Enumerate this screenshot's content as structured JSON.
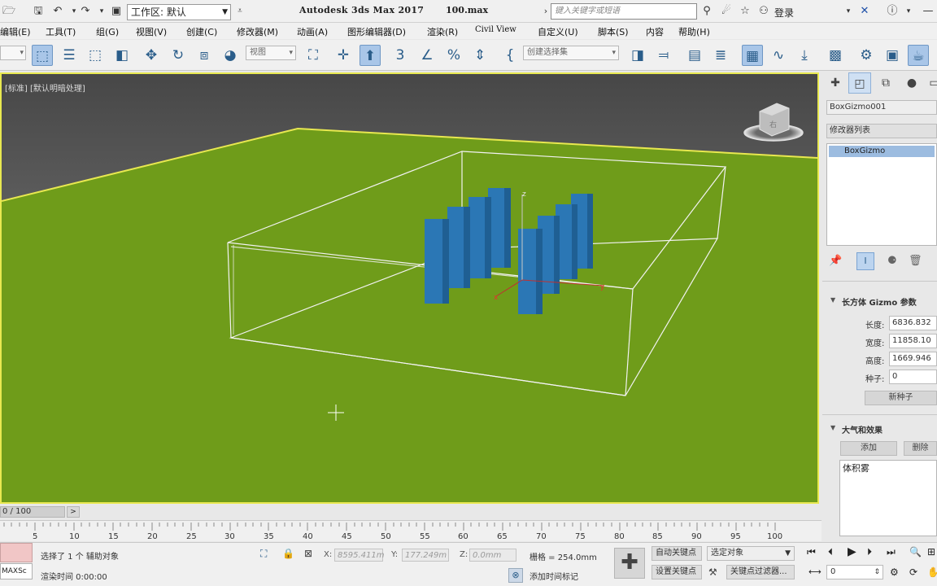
{
  "title_bar": {
    "workspace_label": "工作区: 默认",
    "app_title": "Autodesk 3ds Max 2017",
    "file_name": "100.max",
    "search_placeholder": "键入关键字或短语",
    "login": "登录"
  },
  "menu": [
    "编辑(E)",
    "工具(T)",
    "组(G)",
    "视图(V)",
    "创建(C)",
    "修改器(M)",
    "动画(A)",
    "图形编辑器(D)",
    "渲染(R)",
    "Civil View",
    "自定义(U)",
    "脚本(S)",
    "内容",
    "帮助(H)"
  ],
  "toolbar": {
    "view_dropdown": "视图",
    "selection_set_dropdown": "创建选择集"
  },
  "viewport": {
    "label": "[标准] [默认明暗处理]",
    "viewcube_label": "右",
    "axis_z": "z",
    "axis_y": "y",
    "axis_x": "x"
  },
  "panel": {
    "object_name": "BoxGizmo001",
    "modifier_list_label": "修改器列表",
    "modifier_stack_item": "BoxGizmo",
    "params_title": "长方体 Gizmo 参数",
    "length_label": "长度:",
    "length_value": "6836.832",
    "width_label": "宽度:",
    "width_value": "11858.10",
    "height_label": "高度:",
    "height_value": "1669.946",
    "seed_label": "种子:",
    "seed_value": "0",
    "new_seed_button": "新种子",
    "atmos_title": "大气和效果",
    "add_button": "添加",
    "delete_button": "删除",
    "atmos_list_item": "体积雾"
  },
  "timeline": {
    "frame_counter": "0 / 100",
    "next_label": ">",
    "ticks": [
      "5",
      "10",
      "15",
      "20",
      "25",
      "30",
      "35",
      "40",
      "45",
      "50",
      "55",
      "60",
      "65",
      "70",
      "75",
      "80",
      "85",
      "90",
      "95",
      "100"
    ]
  },
  "status": {
    "maxscript_label": "MAXSc",
    "selection_message": "选择了 1 个 辅助对象",
    "render_time": "渲染时间  0:00:00",
    "x_label": "X:",
    "x_value": "8595.411m",
    "y_label": "Y:",
    "y_value": "177.249m",
    "z_label": "Z:",
    "z_value": "0.0mm",
    "grid_label": "栅格 = 254.0mm",
    "add_time_tag": "添加时间标记",
    "auto_key": "自动关键点",
    "set_key": "设置关键点",
    "selected_object": "选定对象",
    "key_filters": "关键点过滤器...",
    "frame_value": "0"
  },
  "colors": {
    "ground": "#6f9c1a",
    "sky_top": "#4b4b4b",
    "sky_bottom": "#8a8a8a",
    "bar_blue": "#2b77b5",
    "active_border": "#e8e850"
  }
}
